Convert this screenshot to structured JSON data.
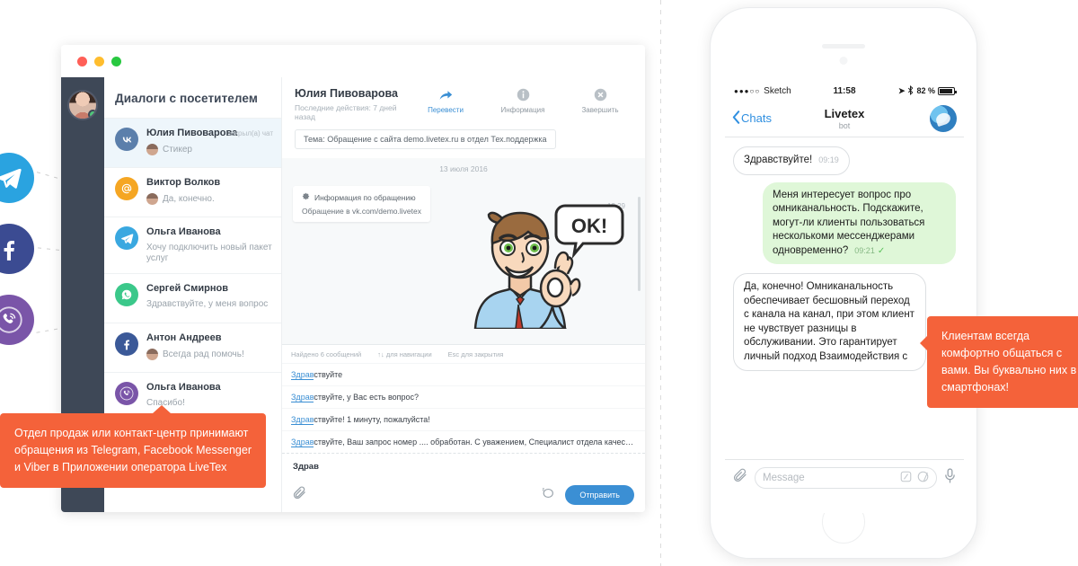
{
  "desktop": {
    "window_controls": [
      "close",
      "minimize",
      "maximize"
    ],
    "dialogs_title": "Диалоги с посетителем",
    "dialogs": [
      {
        "channel": "vk",
        "name": "Юлия Пивоварова",
        "preview": "Стикер",
        "tag": "закрыл(а) чат",
        "has_avatar": true,
        "selected": true
      },
      {
        "channel": "mail",
        "name": "Виктор Волков",
        "preview": "Да, конечно.",
        "tag": "",
        "has_avatar": true,
        "selected": false
      },
      {
        "channel": "tg",
        "name": "Ольга Иванова",
        "preview": "Хочу подключить новый пакет услуг",
        "tag": "",
        "has_avatar": false,
        "selected": false
      },
      {
        "channel": "wa",
        "name": "Сергей Смирнов",
        "preview": "Здравствуйте, у меня вопрос",
        "tag": "",
        "has_avatar": false,
        "selected": false
      },
      {
        "channel": "fb",
        "name": "Антон Андреев",
        "preview": "Всегда рад помочь!",
        "tag": "",
        "has_avatar": true,
        "selected": false
      },
      {
        "channel": "vb",
        "name": "Ольга Иванова",
        "preview": "Спасибо!",
        "tag": "",
        "has_avatar": false,
        "selected": false
      }
    ],
    "conversation": {
      "contact_name": "Юлия Пивоварова",
      "last_action": "Последние действия: 7 дней назад",
      "actions": [
        {
          "icon": "forward-arrow-icon",
          "label": "Перевести"
        },
        {
          "icon": "info-icon",
          "label": "Информация"
        },
        {
          "icon": "close-circle-icon",
          "label": "Завершить"
        }
      ],
      "topic": "Тема: Обращение с сайта demo.livetex.ru в отдел Тех.поддержка",
      "day_separator": "13 июля 2016",
      "info_card": {
        "title": "Информация по обращению",
        "body": "Обращение в vk.com/demo.livetex"
      },
      "sticker_time": "12:29",
      "sticker_text": "OK!"
    },
    "suggestions": {
      "found_label": "Найдено 6 сообщений",
      "nav_hint": "для навигации",
      "esc_hint": "Esc для закрытия",
      "items": [
        {
          "match": "Здрав",
          "rest": "ствуйте"
        },
        {
          "match": "Здрав",
          "rest": "ствуйте, у Вас есть вопрос?"
        },
        {
          "match": "Здрав",
          "rest": "ствуйте! 1 минуту, пожалуйста!"
        },
        {
          "match": "Здрав",
          "rest": "ствуйте, Ваш запрос номер .... обработан. С уважением, Специалист отдела качества, ..."
        }
      ]
    },
    "composer": {
      "typed_text": "Здрав",
      "attach_icon": "paperclip-icon",
      "canned_icon": "quick-reply-icon",
      "send_label": "Отправить"
    }
  },
  "phone": {
    "status": {
      "signal_dots": "●●●○○",
      "carrier": "Sketch",
      "time": "11:58",
      "location_icon": "location-arrow-icon",
      "bluetooth_icon": "bluetooth-icon",
      "battery": "82 %"
    },
    "nav": {
      "back_label": "Chats",
      "title": "Livetex",
      "subtitle": "bot",
      "avatar_icon": "livetex-logo-icon"
    },
    "messages": [
      {
        "side": "in",
        "text": "Здравствуйте!",
        "time": "09:19",
        "read": false
      },
      {
        "side": "out",
        "text": "Меня интересует вопрос про омниканальность. Подскажите, могут-ли клиенты пользоваться несколькоми мессенджерами одновременно?",
        "time": "09:21",
        "read": true
      },
      {
        "side": "in",
        "text": "Да, конечно! Омниканальность обеспечивает бесшовный переход с канала на канал, при этом клиент не чувствует разницы в обслуживании. Это гарантирует личный подход Взаимодействия с",
        "time": "",
        "read": false
      }
    ],
    "input": {
      "placeholder": "Message",
      "attach_icon": "paperclip-icon",
      "sticker_icon": "sticker-icon",
      "emoji_icon": "emoji-icon",
      "mic_icon": "microphone-icon"
    }
  },
  "callouts": {
    "left": "Отдел продаж или контакт-центр принимают обращения из Telegram, Facebook Messenger и Viber в Приложении оператора LiveTex",
    "right": "Клиентам всегда комфортно общаться с вами. Вы буквально них в смартфонах!"
  },
  "social_icons": [
    {
      "name": "telegram-icon",
      "color": "#2aa3e0"
    },
    {
      "name": "facebook-icon",
      "color": "#3b4b92"
    },
    {
      "name": "viber-icon",
      "color": "#7a55a8"
    }
  ]
}
